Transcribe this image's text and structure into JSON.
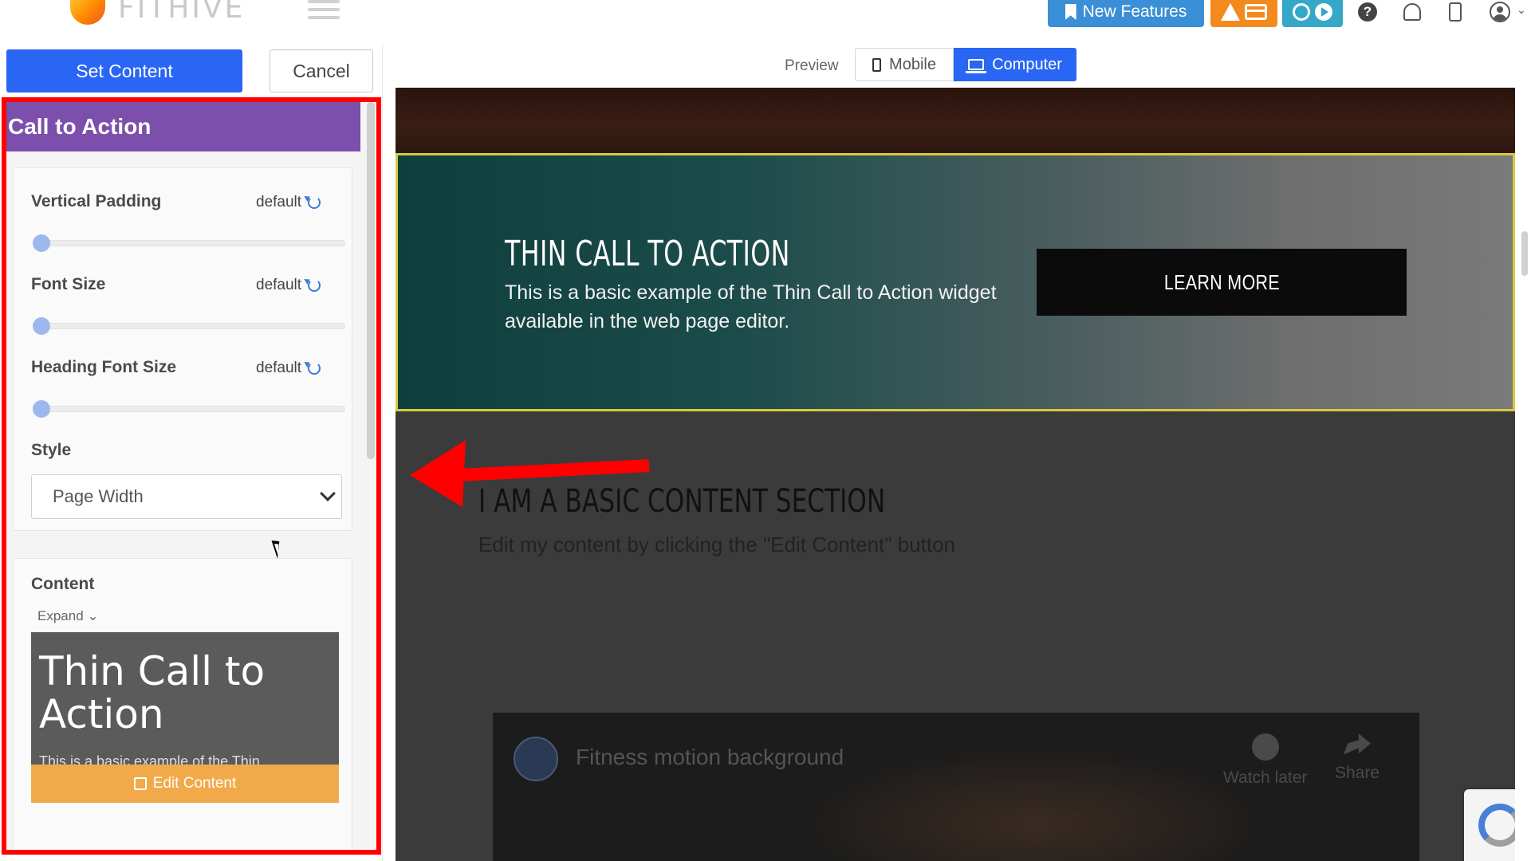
{
  "app": {
    "logo_text": "FITHIVE"
  },
  "header": {
    "new_features_label": "New Features",
    "icons": [
      "bookmark-icon",
      "warning-icon",
      "card-icon",
      "timer-icon",
      "play-icon",
      "help-icon",
      "bell-icon",
      "phone-icon",
      "user-icon"
    ]
  },
  "editor": {
    "set_content_label": "Set Content",
    "cancel_label": "Cancel"
  },
  "panel": {
    "title": "Call to Action",
    "settings": [
      {
        "label": "Vertical Padding",
        "value": "default"
      },
      {
        "label": "Font Size",
        "value": "default"
      },
      {
        "label": "Heading Font Size",
        "value": "default"
      }
    ],
    "style_label": "Style",
    "style_value": "Page Width",
    "content_label": "Content",
    "expand_label": "Expand",
    "content_preview_title": "Thin Call to Action",
    "content_preview_sub": "This is a basic example of the Thin",
    "edit_content_label": "Edit Content"
  },
  "preview_toggle": {
    "preview_label": "Preview",
    "mobile_label": "Mobile",
    "computer_label": "Computer",
    "active": "Computer"
  },
  "canvas": {
    "cta_heading": "THIN CALL TO ACTION",
    "cta_text": "This is a basic example of the Thin Call to Action widget available in the web page editor.",
    "cta_button": "LEARN MORE",
    "basic_heading": "I AM A BASIC CONTENT SECTION",
    "basic_text": "Edit my content by clicking the \"Edit Content\" button",
    "video_title": "Fitness motion background",
    "video_watch_later": "Watch later",
    "video_share": "Share"
  },
  "colors": {
    "primary_blue": "#2a66f4",
    "panel_header": "#7b4fab",
    "highlight_red": "#ff0000",
    "edit_orange": "#f2a94a",
    "cta_outline": "#d8c93a"
  }
}
